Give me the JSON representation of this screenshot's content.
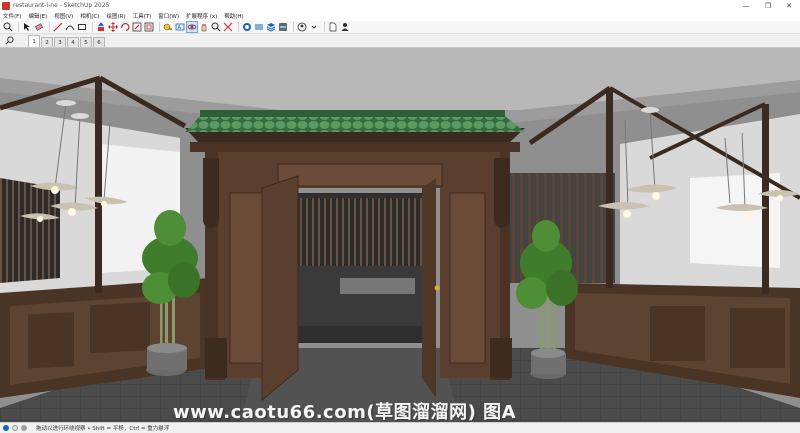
{
  "window": {
    "title": "restaurant-i-ne - SketchUp 2025",
    "controls": [
      "—",
      "❐",
      "✕"
    ]
  },
  "menu": [
    "文件(F)",
    "编辑(E)",
    "视图(V)",
    "相机(C)",
    "绘图(R)",
    "工具(T)",
    "窗口(W)",
    "扩展程序 (x)",
    "帮助(H)"
  ],
  "toolbar": {
    "tools": [
      "search-icon",
      "select-icon",
      "eraser-icon",
      "line-icon",
      "arc-icon",
      "rectangle-icon",
      "pushpull-icon",
      "move-icon",
      "rotate-icon",
      "scale-icon",
      "offset-icon",
      "tape-icon",
      "text-icon",
      "orbit-icon",
      "pan-icon",
      "zoom-icon",
      "zoom-extents-icon",
      "warehouse-icon",
      "extension-icon",
      "layers-icon",
      "styles-icon",
      "user-icon",
      "file-icon",
      "person-icon"
    ]
  },
  "scenes": {
    "tabs": [
      "1",
      "2",
      "3",
      "4",
      "5",
      "6"
    ],
    "active": "1"
  },
  "watermark": "www.caotu66.com(草图溜溜网) 图A",
  "status": {
    "text": "拖动以进行环绕视察 • Shift = 平移，Ctrl = 重力悬浮"
  },
  "colors": {
    "wood": "#5a3f2e",
    "roof_tile": "#4f8a57",
    "bamboo": "#3f7d2c",
    "floor": "#4a4a4a"
  }
}
